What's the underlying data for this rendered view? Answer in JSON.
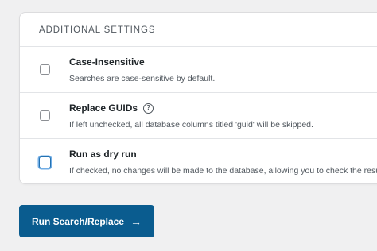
{
  "panel": {
    "title": "ADDITIONAL SETTINGS",
    "options": [
      {
        "label": "Case-Insensitive",
        "description": "Searches are case-sensitive by default.",
        "checked": false,
        "help": false
      },
      {
        "label": "Replace GUIDs",
        "description": "If left unchecked, all database columns titled 'guid' will be skipped.",
        "checked": false,
        "help": true
      },
      {
        "label": "Run as dry run",
        "description": "If checked, no changes will be made to the database, allowing you to check the results beforehand.",
        "checked": false,
        "help": false,
        "focused": true
      }
    ]
  },
  "help_icon_glyph": "?",
  "run_button": {
    "label": "Run Search/Replace",
    "arrow": "→"
  },
  "colors": {
    "accent": "#0a5c8f",
    "focus": "#2271b1"
  }
}
